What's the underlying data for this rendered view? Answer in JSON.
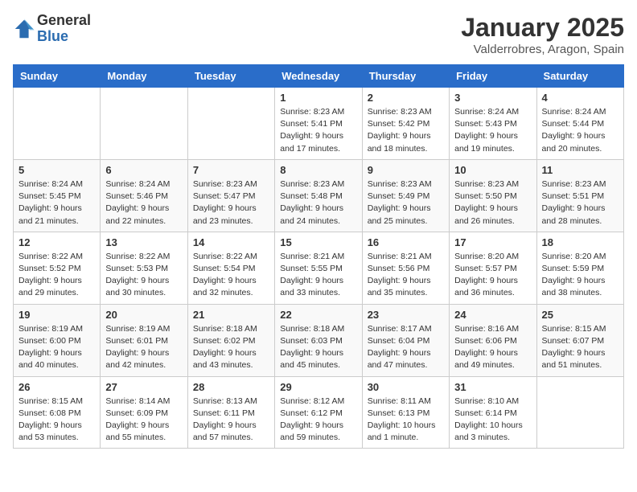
{
  "logo": {
    "general": "General",
    "blue": "Blue"
  },
  "header": {
    "month": "January 2025",
    "location": "Valderrobres, Aragon, Spain"
  },
  "weekdays": [
    "Sunday",
    "Monday",
    "Tuesday",
    "Wednesday",
    "Thursday",
    "Friday",
    "Saturday"
  ],
  "weeks": [
    [
      {
        "day": "",
        "info": ""
      },
      {
        "day": "",
        "info": ""
      },
      {
        "day": "",
        "info": ""
      },
      {
        "day": "1",
        "info": "Sunrise: 8:23 AM\nSunset: 5:41 PM\nDaylight: 9 hours\nand 17 minutes."
      },
      {
        "day": "2",
        "info": "Sunrise: 8:23 AM\nSunset: 5:42 PM\nDaylight: 9 hours\nand 18 minutes."
      },
      {
        "day": "3",
        "info": "Sunrise: 8:24 AM\nSunset: 5:43 PM\nDaylight: 9 hours\nand 19 minutes."
      },
      {
        "day": "4",
        "info": "Sunrise: 8:24 AM\nSunset: 5:44 PM\nDaylight: 9 hours\nand 20 minutes."
      }
    ],
    [
      {
        "day": "5",
        "info": "Sunrise: 8:24 AM\nSunset: 5:45 PM\nDaylight: 9 hours\nand 21 minutes."
      },
      {
        "day": "6",
        "info": "Sunrise: 8:24 AM\nSunset: 5:46 PM\nDaylight: 9 hours\nand 22 minutes."
      },
      {
        "day": "7",
        "info": "Sunrise: 8:23 AM\nSunset: 5:47 PM\nDaylight: 9 hours\nand 23 minutes."
      },
      {
        "day": "8",
        "info": "Sunrise: 8:23 AM\nSunset: 5:48 PM\nDaylight: 9 hours\nand 24 minutes."
      },
      {
        "day": "9",
        "info": "Sunrise: 8:23 AM\nSunset: 5:49 PM\nDaylight: 9 hours\nand 25 minutes."
      },
      {
        "day": "10",
        "info": "Sunrise: 8:23 AM\nSunset: 5:50 PM\nDaylight: 9 hours\nand 26 minutes."
      },
      {
        "day": "11",
        "info": "Sunrise: 8:23 AM\nSunset: 5:51 PM\nDaylight: 9 hours\nand 28 minutes."
      }
    ],
    [
      {
        "day": "12",
        "info": "Sunrise: 8:22 AM\nSunset: 5:52 PM\nDaylight: 9 hours\nand 29 minutes."
      },
      {
        "day": "13",
        "info": "Sunrise: 8:22 AM\nSunset: 5:53 PM\nDaylight: 9 hours\nand 30 minutes."
      },
      {
        "day": "14",
        "info": "Sunrise: 8:22 AM\nSunset: 5:54 PM\nDaylight: 9 hours\nand 32 minutes."
      },
      {
        "day": "15",
        "info": "Sunrise: 8:21 AM\nSunset: 5:55 PM\nDaylight: 9 hours\nand 33 minutes."
      },
      {
        "day": "16",
        "info": "Sunrise: 8:21 AM\nSunset: 5:56 PM\nDaylight: 9 hours\nand 35 minutes."
      },
      {
        "day": "17",
        "info": "Sunrise: 8:20 AM\nSunset: 5:57 PM\nDaylight: 9 hours\nand 36 minutes."
      },
      {
        "day": "18",
        "info": "Sunrise: 8:20 AM\nSunset: 5:59 PM\nDaylight: 9 hours\nand 38 minutes."
      }
    ],
    [
      {
        "day": "19",
        "info": "Sunrise: 8:19 AM\nSunset: 6:00 PM\nDaylight: 9 hours\nand 40 minutes."
      },
      {
        "day": "20",
        "info": "Sunrise: 8:19 AM\nSunset: 6:01 PM\nDaylight: 9 hours\nand 42 minutes."
      },
      {
        "day": "21",
        "info": "Sunrise: 8:18 AM\nSunset: 6:02 PM\nDaylight: 9 hours\nand 43 minutes."
      },
      {
        "day": "22",
        "info": "Sunrise: 8:18 AM\nSunset: 6:03 PM\nDaylight: 9 hours\nand 45 minutes."
      },
      {
        "day": "23",
        "info": "Sunrise: 8:17 AM\nSunset: 6:04 PM\nDaylight: 9 hours\nand 47 minutes."
      },
      {
        "day": "24",
        "info": "Sunrise: 8:16 AM\nSunset: 6:06 PM\nDaylight: 9 hours\nand 49 minutes."
      },
      {
        "day": "25",
        "info": "Sunrise: 8:15 AM\nSunset: 6:07 PM\nDaylight: 9 hours\nand 51 minutes."
      }
    ],
    [
      {
        "day": "26",
        "info": "Sunrise: 8:15 AM\nSunset: 6:08 PM\nDaylight: 9 hours\nand 53 minutes."
      },
      {
        "day": "27",
        "info": "Sunrise: 8:14 AM\nSunset: 6:09 PM\nDaylight: 9 hours\nand 55 minutes."
      },
      {
        "day": "28",
        "info": "Sunrise: 8:13 AM\nSunset: 6:11 PM\nDaylight: 9 hours\nand 57 minutes."
      },
      {
        "day": "29",
        "info": "Sunrise: 8:12 AM\nSunset: 6:12 PM\nDaylight: 9 hours\nand 59 minutes."
      },
      {
        "day": "30",
        "info": "Sunrise: 8:11 AM\nSunset: 6:13 PM\nDaylight: 10 hours\nand 1 minute."
      },
      {
        "day": "31",
        "info": "Sunrise: 8:10 AM\nSunset: 6:14 PM\nDaylight: 10 hours\nand 3 minutes."
      },
      {
        "day": "",
        "info": ""
      }
    ]
  ]
}
